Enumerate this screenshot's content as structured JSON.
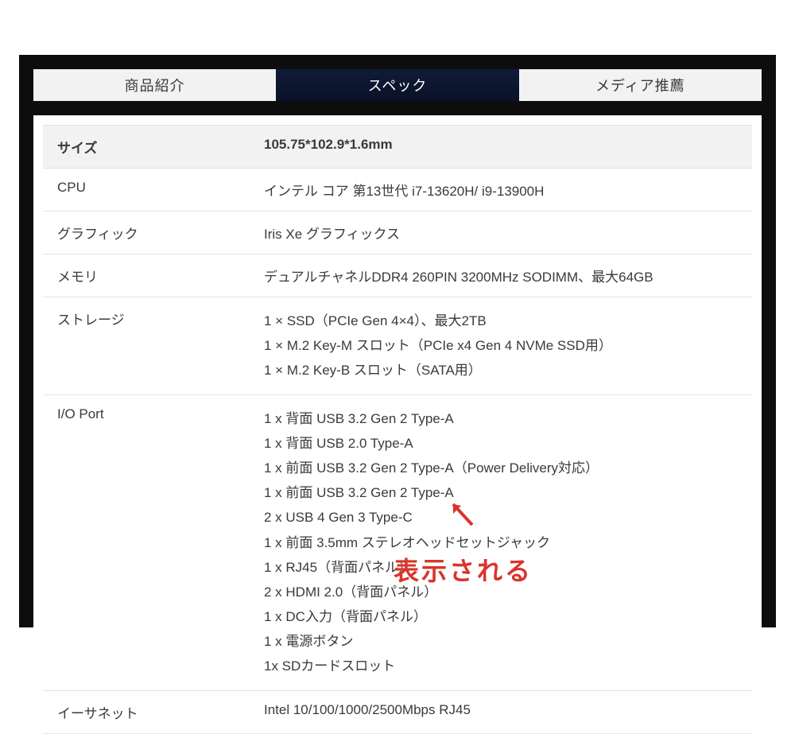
{
  "tabs": {
    "intro": "商品紹介",
    "spec": "スペック",
    "media": "メディア推薦"
  },
  "specs": {
    "size": {
      "label": "サイズ",
      "value": "105.75*102.9*1.6mm"
    },
    "cpu": {
      "label": "CPU",
      "value": "インテル コア 第13世代 i7-13620H/ i9-13900H"
    },
    "graphics": {
      "label": "グラフィック",
      "value": "Iris Xe グラフィックス"
    },
    "memory": {
      "label": "メモリ",
      "value": "デュアルチャネルDDR4 260PIN 3200MHz SODIMM、最大64GB"
    },
    "storage": {
      "label": "ストレージ",
      "lines": [
        "1 × SSD（PCIe Gen 4×4）、最大2TB",
        "1 × M.2 Key-M スロット（PCIe x4 Gen 4 NVMe SSD用）",
        "1 × M.2 Key-B スロット（SATA用）"
      ]
    },
    "io": {
      "label": "I/O Port",
      "lines": [
        "1 x 背面 USB 3.2 Gen 2 Type-A",
        "1 x 背面 USB 2.0 Type-A",
        "1 x 前面 USB 3.2 Gen 2 Type-A（Power Delivery対応）",
        "1 x 前面 USB 3.2 Gen 2 Type-A",
        "2 x USB 4 Gen 3 Type-C",
        "1 x 前面 3.5mm ステレオヘッドセットジャック",
        "1 x RJ45（背面パネル）",
        "2 x HDMI 2.0（背面パネル）",
        "1 x DC入力（背面パネル）",
        "1 x 電源ボタン",
        "1x SDカードスロット"
      ]
    },
    "ethernet": {
      "label": "イーサネット",
      "value": "Intel 10/100/1000/2500Mbps RJ45"
    }
  },
  "annotation": {
    "text": "表示される"
  }
}
